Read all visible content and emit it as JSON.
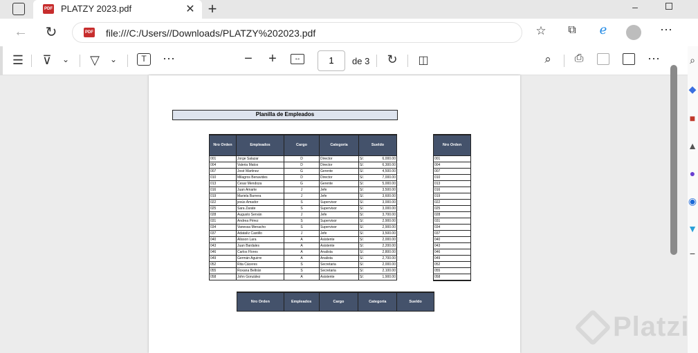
{
  "browser": {
    "tab_title": "PLATZY 2023.pdf",
    "tab_icon": "PDF",
    "url": "file:///C:/Users//Downloads/PLATZY%202023.pdf"
  },
  "pdf_toolbar": {
    "current_page": "1",
    "page_count": "de 3"
  },
  "document": {
    "title": "Planilla de Empleados",
    "table": {
      "headers": [
        "Nro Orden",
        "Empleados",
        "Cargo",
        "Categoría",
        "Sueldo"
      ],
      "rows": [
        [
          "001",
          "Jorge Salazar",
          "D",
          "Director",
          "S/.",
          "6,000.00"
        ],
        [
          "004",
          "Valeria Matos",
          "D",
          "Director",
          "S/.",
          "6,300.00"
        ],
        [
          "007",
          "José Martinez",
          "G",
          "Gerente",
          "S/.",
          "4,500.00"
        ],
        [
          "010",
          "Milagros Benavides",
          "D",
          "Director",
          "S/.",
          "7,000.00"
        ],
        [
          "013",
          "Cesar Mendoza",
          "G",
          "Gerente",
          "S/.",
          "5,000.00"
        ],
        [
          "016",
          "Juan Amarte",
          "J",
          "Jefe",
          "S/.",
          "3,500.00"
        ],
        [
          "019",
          "Mariela Barrera",
          "J",
          "Jefe",
          "S/.",
          "3,600.00"
        ],
        [
          "022",
          "jesús Amador",
          "S",
          "Supervisor",
          "S/.",
          "3,000.00"
        ],
        [
          "025",
          "Sara Zarate",
          "S",
          "Supervisor",
          "S/.",
          "3,000.00"
        ],
        [
          "028",
          "Augusto Serván",
          "J",
          "Jefe",
          "S/.",
          "3,700.00"
        ],
        [
          "031",
          "Andrea Pérez",
          "S",
          "Supervisor",
          "S/.",
          "2,900.00"
        ],
        [
          "034",
          "Vanessa Menacho",
          "S",
          "Supervisor",
          "S/.",
          "2,900.00"
        ],
        [
          "037",
          "Adatalíz Castillo",
          "J",
          "Jefe",
          "S/.",
          "3,500.00"
        ],
        [
          "040",
          "Alisson Lara",
          "A",
          "Asistente",
          "S/.",
          "2,000.00"
        ],
        [
          "043",
          "Juan Bardales",
          "A",
          "Asistente",
          "S/.",
          "2,200.00"
        ],
        [
          "046",
          "Carlos Flores",
          "A",
          "Analista",
          "S/.",
          "2,800.00"
        ],
        [
          "049",
          "Germán Aguirre",
          "A",
          "Analista",
          "S/.",
          "2,700.00"
        ],
        [
          "052",
          "Rita Cáceres",
          "S",
          "Secretaria",
          "S/.",
          "2,000.00"
        ],
        [
          "055",
          "Roxana Beltrán",
          "S",
          "Secretaria",
          "S/.",
          "2,100.00"
        ],
        [
          "058",
          "John González",
          "A",
          "Asistente",
          "S/.",
          "1,900.00"
        ]
      ]
    },
    "nro_table_header": "Nro Orden",
    "bottom_headers": [
      "Nro Orden",
      "Empleados",
      "Cargo",
      "Categoría",
      "Sueldo"
    ]
  },
  "watermark": "Platzi",
  "colors": {
    "table_header": "#44526b",
    "title_fill": "#dde3ee",
    "pdf_badge": "#c72d2d"
  }
}
